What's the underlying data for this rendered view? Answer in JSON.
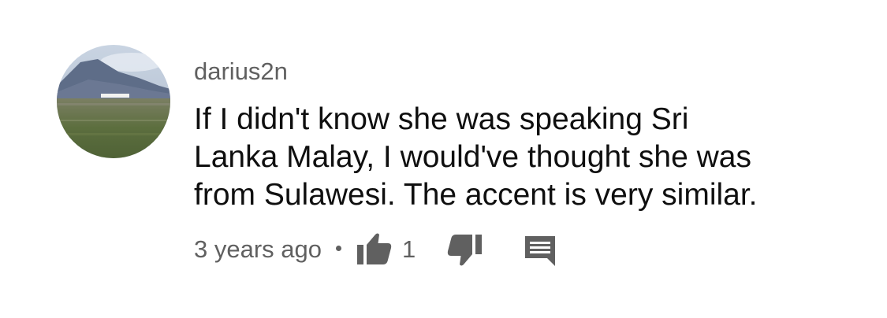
{
  "comment": {
    "author": "darius2n",
    "text_lines": [
      "If I didn't know she was speaking Sri",
      "Lanka Malay, I would've thought she was",
      "from Sulawesi. The accent is very similar."
    ],
    "timestamp": "3 years ago",
    "like_count": "1",
    "icons": {
      "like": "thumbs-up-icon",
      "dislike": "thumbs-down-icon",
      "reply": "reply-comment-icon"
    },
    "colors": {
      "text": "#0f0f0f",
      "secondary": "#606060",
      "icon": "#606060"
    }
  }
}
